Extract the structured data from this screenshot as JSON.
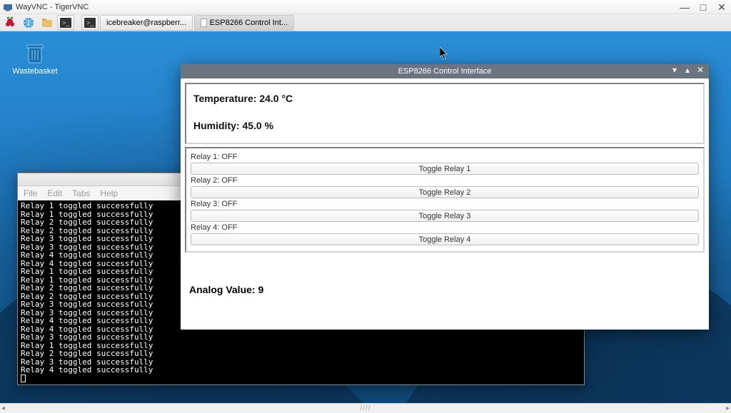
{
  "vnc": {
    "title": "WayVNC - TigerVNC"
  },
  "taskbar": {
    "task_terminal": "icebreaker@raspberr...",
    "task_esp": "ESP8266 Control Int..."
  },
  "desktop": {
    "wastebasket_label": "Wastebasket"
  },
  "terminal": {
    "menu": {
      "file": "File",
      "edit": "Edit",
      "tabs": "Tabs",
      "help": "Help"
    },
    "lines": [
      "Relay 1 toggled successfully",
      "Relay 1 toggled successfully",
      "Relay 2 toggled successfully",
      "Relay 2 toggled successfully",
      "Relay 3 toggled successfully",
      "Relay 3 toggled successfully",
      "Relay 4 toggled successfully",
      "Relay 4 toggled successfully",
      "Relay 1 toggled successfully",
      "Relay 1 toggled successfully",
      "Relay 2 toggled successfully",
      "Relay 2 toggled successfully",
      "Relay 3 toggled successfully",
      "Relay 3 toggled successfully",
      "Relay 4 toggled successfully",
      "Relay 4 toggled successfully",
      "Relay 3 toggled successfully",
      "Relay 1 toggled successfully",
      "Relay 2 toggled successfully",
      "Relay 3 toggled successfully",
      "Relay 4 toggled successfully"
    ]
  },
  "esp": {
    "title": "ESP8266 Control Interface",
    "temperature_label": "Temperature: 24.0 °C",
    "humidity_label": "Humidity: 45.0 %",
    "relays": [
      {
        "status": "Relay 1: OFF",
        "button": "Toggle Relay 1"
      },
      {
        "status": "Relay 2: OFF",
        "button": "Toggle Relay 2"
      },
      {
        "status": "Relay 3: OFF",
        "button": "Toggle Relay 3"
      },
      {
        "status": "Relay 4: OFF",
        "button": "Toggle Relay 4"
      }
    ],
    "analog_label": "Analog Value: 9"
  }
}
